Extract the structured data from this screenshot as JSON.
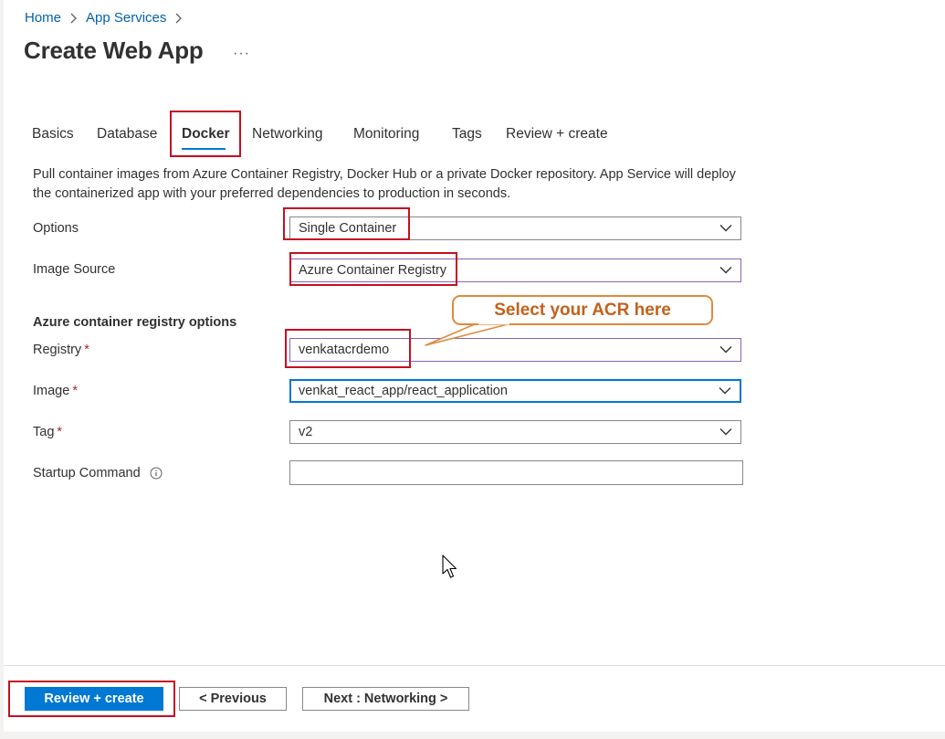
{
  "breadcrumb": {
    "items": [
      "Home",
      "App Services"
    ]
  },
  "page": {
    "title": "Create Web App",
    "more": "···"
  },
  "tabs": [
    "Basics",
    "Database",
    "Docker",
    "Networking",
    "Monitoring",
    "Tags",
    "Review + create"
  ],
  "active_tab": "Docker",
  "description": "Pull container images from Azure Container Registry, Docker Hub or a private Docker repository. App Service will deploy the containerized app with your preferred dependencies to production in seconds.",
  "fields": {
    "options": {
      "label": "Options",
      "value": "Single Container"
    },
    "image_source": {
      "label": "Image Source",
      "value": "Azure Container Registry"
    },
    "section_heading": "Azure container registry options",
    "registry": {
      "label": "Registry",
      "required": "*",
      "value": "venkatacrdemo"
    },
    "image": {
      "label": "Image",
      "required": "*",
      "value": "venkat_react_app/react_application"
    },
    "tag": {
      "label": "Tag",
      "required": "*",
      "value": "v2"
    },
    "startup_command": {
      "label": "Startup Command",
      "value": ""
    }
  },
  "callout": {
    "text": "Select your ACR here"
  },
  "footer": {
    "review_create": "Review + create",
    "previous": "< Previous",
    "next": "Next : Networking >"
  },
  "colors": {
    "accent": "#0078d4",
    "link": "#0063b1",
    "highlight": "#c50f1f",
    "callout_text": "#c4611a",
    "callout_border": "#e08a3c",
    "required": "#a4262c"
  },
  "icons": [
    "chevron-right-icon",
    "more-icon",
    "chevron-down-icon",
    "info-icon",
    "mouse-cursor-icon"
  ]
}
